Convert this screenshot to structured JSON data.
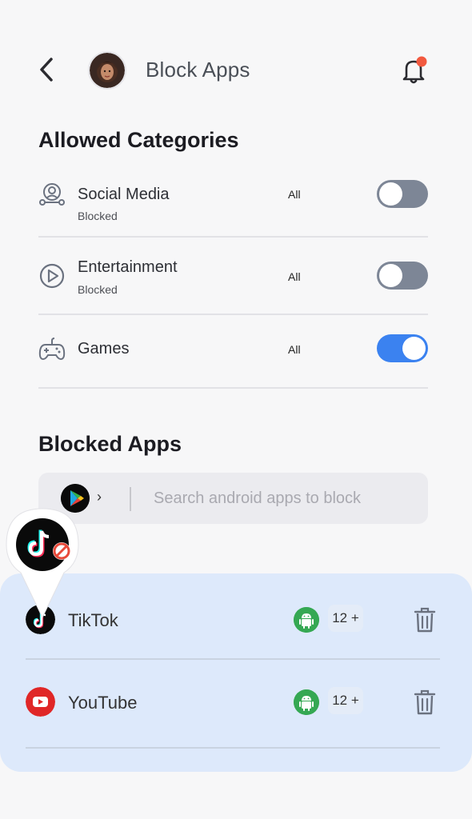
{
  "header": {
    "title": "Block Apps",
    "back_icon": "chevron-left-icon",
    "notification_icon": "bell-icon",
    "notification_dot_color": "#f2593f"
  },
  "allowed": {
    "title": "Allowed Categories",
    "categories": [
      {
        "name": "Social Media",
        "status": "Blocked",
        "scope": "All",
        "enabled": false,
        "icon": "social-media-icon"
      },
      {
        "name": "Entertainment",
        "status": "Blocked",
        "scope": "All",
        "enabled": false,
        "icon": "play-circle-icon"
      },
      {
        "name": "Games",
        "status": "",
        "scope": "All",
        "enabled": true,
        "icon": "gamepad-icon"
      }
    ]
  },
  "blocked": {
    "title": "Blocked Apps",
    "search_placeholder": "Search android apps to block",
    "store_chevron": "›",
    "apps": [
      {
        "name": "TikTok",
        "age": "12 +",
        "icon": "tiktok-icon",
        "platform": "android"
      },
      {
        "name": "YouTube",
        "age": "12 +",
        "icon": "youtube-icon",
        "platform": "android"
      }
    ]
  },
  "colors": {
    "accent": "#3b82f0",
    "toggle_off": "#7d8696",
    "panel": "#dde9fb",
    "android": "#35a853",
    "youtube": "#e02727",
    "block_red": "#e84a3a"
  }
}
